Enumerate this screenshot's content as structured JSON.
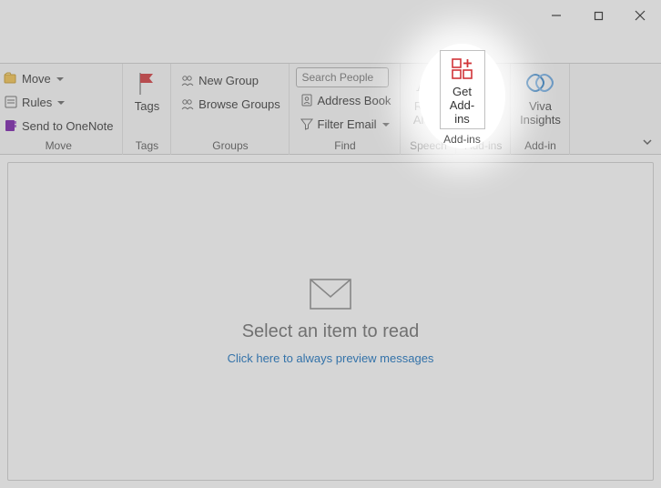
{
  "window_controls": {
    "minimize": "Minimize",
    "maximize": "Maximize",
    "close": "Close"
  },
  "ribbon": {
    "move_group": {
      "label": "Move",
      "move": "Move",
      "rules": "Rules",
      "onenote": "Send to OneNote"
    },
    "tags_group": {
      "label": "Tags",
      "button": "Tags"
    },
    "groups_group": {
      "label": "Groups",
      "new_group": "New Group",
      "browse_groups": "Browse Groups"
    },
    "find_group": {
      "label": "Find",
      "search_placeholder": "Search People",
      "address_book": "Address Book",
      "filter_email": "Filter Email"
    },
    "speech_group": {
      "label": "Speech",
      "read_aloud_1": "Read",
      "read_aloud_2": "Aloud"
    },
    "addins_group": {
      "label": "Add-ins",
      "get_1": "Get",
      "get_2": "Add-ins"
    },
    "addin_group": {
      "label": "Add-in",
      "viva_1": "Viva",
      "viva_2": "Insights"
    }
  },
  "reading_pane": {
    "empty_title": "Select an item to read",
    "link": "Click here to always preview messages"
  }
}
